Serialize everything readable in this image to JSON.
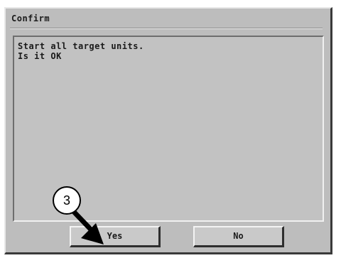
{
  "dialog": {
    "title": "Confirm",
    "message": "Start all target units.\nIs it OK"
  },
  "buttons": {
    "yes_label": "Yes",
    "no_label": "No"
  },
  "annotation": {
    "step_number": "3",
    "arrow_icon": "arrow-down-right-icon",
    "arrow_color": "#000000"
  },
  "colors": {
    "dialog_background": "#bdbdbd",
    "panel_background": "#c2c2c2"
  }
}
